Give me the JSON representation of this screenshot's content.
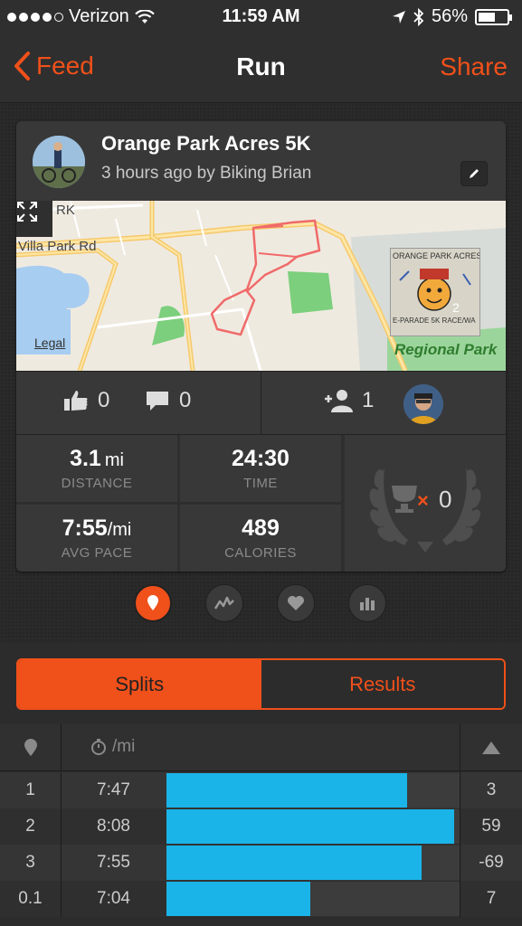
{
  "status_bar": {
    "carrier": "Verizon",
    "time": "11:59 AM",
    "battery": "56%",
    "icons": [
      "signal-dots-icon",
      "wifi-icon",
      "location-arrow-icon",
      "bluetooth-icon",
      "battery-icon"
    ]
  },
  "nav": {
    "back_label": "Feed",
    "title": "Run",
    "share_label": "Share"
  },
  "activity": {
    "title": "Orange Park Acres 5K",
    "subtitle": "3 hours ago by Biking Brian"
  },
  "map": {
    "street_label": "Villa Park Rd",
    "street_fragment": "RK",
    "legal_label": "Legal",
    "park_label": "Regional Park",
    "photo_count": "2",
    "photo_text_top": "ORANGE PARK ACRES",
    "photo_text_bottom": "E-PARADE 5K RACE/WA"
  },
  "social": {
    "kudos_count": "0",
    "comments_count": "0",
    "athletes_count": "1"
  },
  "stats": {
    "distance_value": "3.1",
    "distance_unit": "mi",
    "distance_label": "DISTANCE",
    "time_value": "24:30",
    "time_label": "TIME",
    "pace_value": "7:55",
    "pace_unit": "/mi",
    "pace_label": "AVG PACE",
    "calories_value": "489",
    "calories_label": "CALORIES",
    "achievements_count": "0",
    "achievements_mark": "×"
  },
  "segments": {
    "splits_label": "Splits",
    "results_label": "Results"
  },
  "splits": {
    "pace_header": "/mi",
    "rows": [
      {
        "split": "1",
        "pace": "7:47",
        "elevation": "3",
        "bar_fraction": 0.82
      },
      {
        "split": "2",
        "pace": "8:08",
        "elevation": "59",
        "bar_fraction": 0.98
      },
      {
        "split": "3",
        "pace": "7:55",
        "elevation": "-69",
        "bar_fraction": 0.87
      },
      {
        "split": "0.1",
        "pace": "7:04",
        "elevation": "7",
        "bar_fraction": 0.49
      }
    ]
  },
  "colors": {
    "accent": "#f0501a",
    "bar": "#1ab4e8",
    "route": "#f06a6a"
  }
}
